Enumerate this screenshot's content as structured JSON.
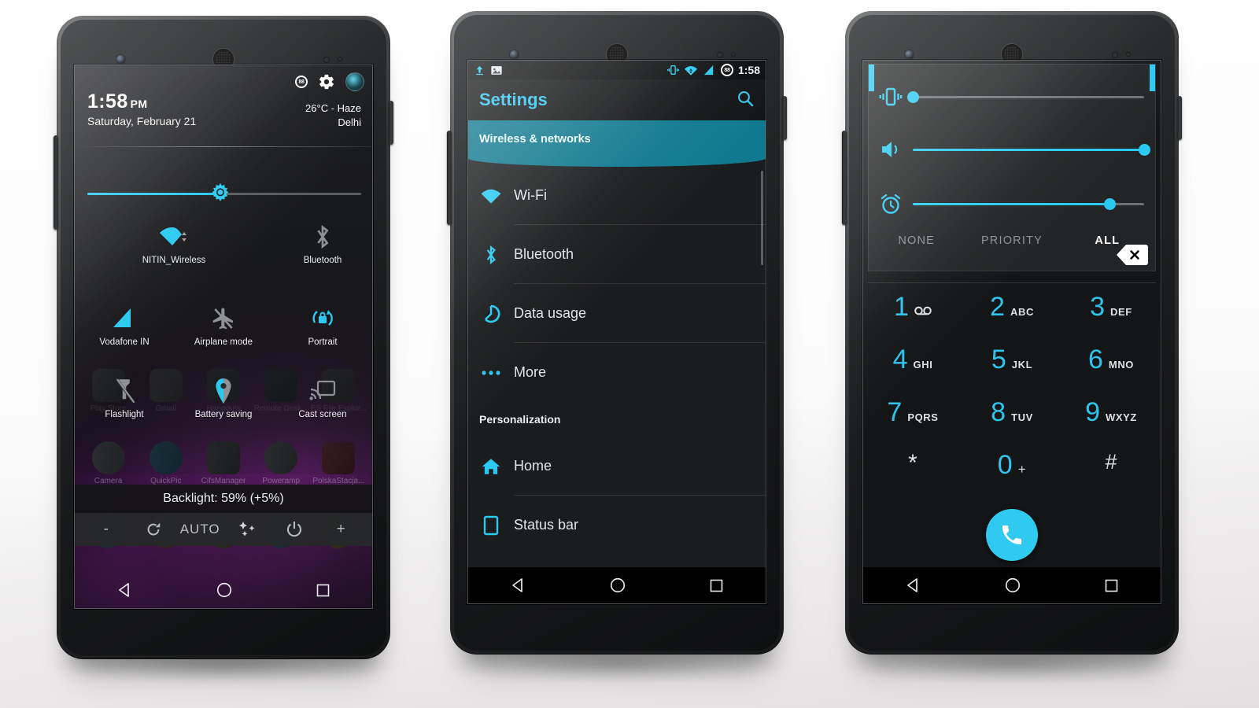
{
  "phone1": {
    "name": "notification-shade",
    "statusbar": {
      "battery_level": "88",
      "gear": "gear-icon",
      "avatar": "user-avatar"
    },
    "clock": {
      "time": "1:58",
      "ampm": "PM",
      "date": "Saturday, February 21"
    },
    "weather": {
      "temp_condition": "26°C - Haze",
      "city": "Delhi"
    },
    "brightness": {
      "percent": 59
    },
    "tiles": [
      {
        "label": "NITIN_Wireless",
        "icon": "wifi-icon",
        "active": true
      },
      {
        "label": "Bluetooth",
        "icon": "bluetooth-icon",
        "active": false
      },
      {
        "label": "Vodafone IN",
        "icon": "signal-icon",
        "active": true
      },
      {
        "label": "Airplane mode",
        "icon": "airplane-off-icon",
        "active": false
      },
      {
        "label": "Portrait",
        "icon": "rotation-lock-icon",
        "active": true
      },
      {
        "label": "Flashlight",
        "icon": "flashlight-off-icon",
        "active": false
      },
      {
        "label": "Battery saving",
        "icon": "location-icon",
        "active": true
      },
      {
        "label": "Cast screen",
        "icon": "cast-icon",
        "active": false
      }
    ],
    "backlight": {
      "text": "Backlight: 59% (+5%)",
      "tools": [
        "-",
        "refresh-icon",
        "AUTO",
        "stars-icon",
        "power-icon",
        "+"
      ]
    },
    "home_apps": [
      "Play Store",
      "Gmail",
      "Hangouts",
      "Remote Desk...",
      "ES File Explor...",
      "Camera",
      "QuickPic",
      "CifsManager",
      "Poweramp",
      "PolskaStacja..."
    ]
  },
  "phone2": {
    "name": "settings-screen",
    "statusbar": {
      "time": "1:58",
      "battery_level": "88",
      "left_icons": [
        "upload-icon",
        "screenshot-icon"
      ],
      "right_icons": [
        "vibrate-icon",
        "wifi-icon",
        "signal-icon"
      ]
    },
    "actionbar": {
      "title": "Settings",
      "search": "search-icon"
    },
    "sections": [
      {
        "header": "Wireless & networks",
        "highlight": true,
        "items": [
          {
            "label": "Wi-Fi",
            "icon": "wifi-icon"
          },
          {
            "label": "Bluetooth",
            "icon": "bluetooth-icon"
          },
          {
            "label": "Data usage",
            "icon": "data-usage-icon"
          },
          {
            "label": "More",
            "icon": "more-icon"
          }
        ]
      },
      {
        "header": "Personalization",
        "highlight": false,
        "items": [
          {
            "label": "Home",
            "icon": "home-icon"
          },
          {
            "label": "Status bar",
            "icon": "status-bar-icon"
          }
        ]
      }
    ]
  },
  "phone3": {
    "name": "volume-and-dialer",
    "volume": {
      "sliders": [
        {
          "icon": "vibrate-icon",
          "name": "ringer",
          "value": 0
        },
        {
          "icon": "speaker-icon",
          "name": "media",
          "value": 100
        },
        {
          "icon": "alarm-icon",
          "name": "alarm",
          "value": 85
        }
      ],
      "zen_modes": [
        "NONE",
        "PRIORITY",
        "ALL"
      ],
      "zen_selected": "ALL",
      "clear_label": "clear-all-icon"
    },
    "dialpad": {
      "keys": [
        {
          "digit": "1",
          "sub": "voicemail-icon"
        },
        {
          "digit": "2",
          "sub": "ABC"
        },
        {
          "digit": "3",
          "sub": "DEF"
        },
        {
          "digit": "4",
          "sub": "GHI"
        },
        {
          "digit": "5",
          "sub": "JKL"
        },
        {
          "digit": "6",
          "sub": "MNO"
        },
        {
          "digit": "7",
          "sub": "PQRS"
        },
        {
          "digit": "8",
          "sub": "TUV"
        },
        {
          "digit": "9",
          "sub": "WXYZ"
        },
        {
          "digit": "*",
          "sub": ""
        },
        {
          "digit": "0",
          "sub": "+"
        },
        {
          "digit": "#",
          "sub": ""
        }
      ],
      "call_button": "call-icon"
    }
  },
  "navbar": {
    "back": "back-icon",
    "home": "home-circle-icon",
    "recents": "recents-square-icon"
  },
  "colors": {
    "accent": "#2ec4ee",
    "accent_strong": "#29c9f2",
    "teal_header": "#10798f",
    "screen_bg": "#1b1c1d"
  }
}
